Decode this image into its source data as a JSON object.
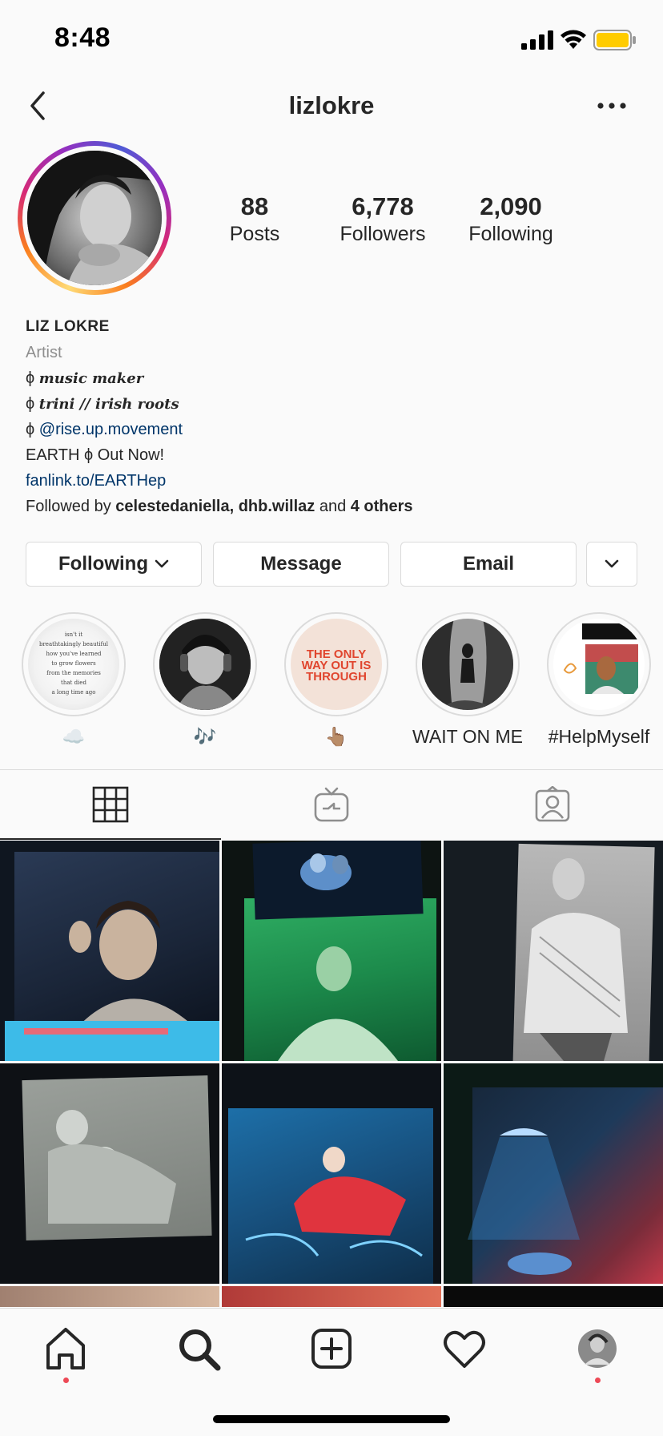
{
  "status_bar": {
    "time": "8:48",
    "battery_color": "#ffcc00"
  },
  "header": {
    "username": "lizlokre",
    "back_icon": "chevron-left-icon",
    "more_icon": "ellipsis-icon"
  },
  "profile": {
    "stats": [
      {
        "value": "88",
        "label": "Posts"
      },
      {
        "value": "6,778",
        "label": "Followers"
      },
      {
        "value": "2,090",
        "label": "Following"
      }
    ],
    "name": "LIZ LOKRE",
    "category": "Artist",
    "bio_lines": [
      {
        "prefix": "ϕ ",
        "text": "music maker"
      },
      {
        "prefix": "ϕ ",
        "text": "trini // irish roots"
      },
      {
        "prefix": "ϕ ",
        "text": "@rise.up.movement"
      }
    ],
    "release_line": "EARTH ϕ Out Now!",
    "link": "fanlink.to/EARTHep",
    "followed_by": {
      "prefix": "Followed by ",
      "names": "celestedaniella, dhb.willaz",
      "middle": " and ",
      "others": "4 others"
    }
  },
  "actions": {
    "following": "Following",
    "message": "Message",
    "email": "Email"
  },
  "highlights": [
    {
      "label": "☁️",
      "text": "isn't it\nbreathtakingly beautiful\nhow you've learned\nto grow flowers\nfrom the memories\nthat died\na long time ago"
    },
    {
      "label": "🎶"
    },
    {
      "label": "👆🏽",
      "text": "THE ONLY WAY OUT IS THROUGH"
    },
    {
      "label": "WAIT ON ME"
    },
    {
      "label": "#HelpMyself"
    }
  ],
  "colors": {
    "link": "#003569",
    "muted": "#8e8e8e",
    "border": "#dbdbdb",
    "notification_dot": "#ed4956"
  },
  "tabs": [
    "grid-icon",
    "igtv-icon",
    "tagged-icon"
  ],
  "bottom_nav": [
    "home-icon",
    "search-icon",
    "new-post-icon",
    "heart-icon",
    "profile-avatar"
  ]
}
